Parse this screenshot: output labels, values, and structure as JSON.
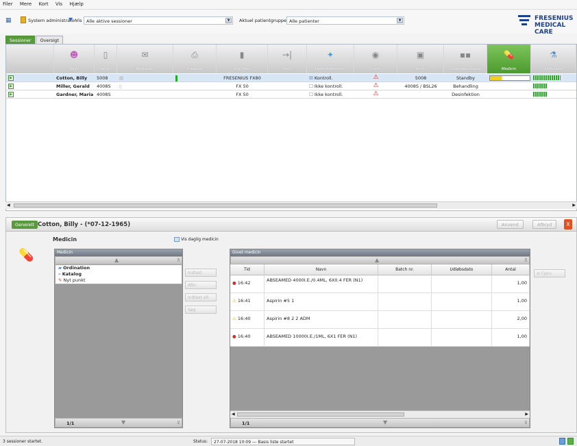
{
  "menu": [
    "Filer",
    "Mere",
    "Kort",
    "Vis",
    "Hjælp"
  ],
  "toolbar": {
    "user": "System administrator",
    "filter_label": "Vis",
    "filter_value": "Alle aktive sessioner",
    "group_label": "Aktuel patientgruppe:",
    "group_value": "Alle patienter"
  },
  "brand": {
    "line1": "FRESENIUS",
    "line2": "MEDICAL CARE",
    "color": "#1b3f8b"
  },
  "tabs": [
    "Sessioner",
    "Oversigt"
  ],
  "grid": {
    "columns": [
      "Navn",
      "Udstyr",
      "Beskeder",
      "Rapport",
      "Dia filter",
      "Stof",
      "Desinfektionsm.",
      "Conn",
      "Kort",
      "Udstyrets status",
      "Medicin",
      "Ordinatio"
    ],
    "rows": [
      {
        "name": "Cotton, Billy",
        "device": "5008",
        "filter": "FRESENIUS FX80",
        "disinf": "Kontroll.",
        "card": "5008",
        "status": "Standby"
      },
      {
        "name": "Miller, Gerald",
        "device": "4008S",
        "filter": "FX 50",
        "disinf": "Ikke kontroll.",
        "card": "4008S / BSL26",
        "status": "Behandling"
      },
      {
        "name": "Gardner, Maria",
        "device": "4008S",
        "filter": "FX 50",
        "disinf": "Ikke kontroll.",
        "card": "",
        "status": "Desinfektion"
      }
    ]
  },
  "panel": {
    "tab": "Generelt",
    "title": "Cotton, Billy - (*07-12-1965)",
    "apply": "Anvend",
    "cancel": "Afbryd",
    "close": "X",
    "section": "Medicin",
    "daily_check": "Vis daglig medicin",
    "left_box": "Medicin",
    "tree": [
      "Ordination",
      "Katalog",
      "Nyt punkt"
    ],
    "side_buttons": [
      "Indtast",
      "Afbr.",
      "Indtast alt",
      "Søg"
    ],
    "right_box": "Givet medicin",
    "remove": "Fjern",
    "given_cols": [
      "Tid",
      "Navn",
      "Batch nr.",
      "Udløbsdato",
      "Antal"
    ],
    "given_rows": [
      {
        "time": "16:42",
        "name": "ABSEAMED 4000I.E./0.4ML, 6X0.4 FER (N1)",
        "qty": "1,00",
        "icon": "red"
      },
      {
        "time": "16:41",
        "name": "Aspirin #5 1",
        "qty": "1,00",
        "icon": "warn"
      },
      {
        "time": "16:40",
        "name": "Aspirin #8 2 2 ADM",
        "qty": "2,00",
        "icon": "warn"
      },
      {
        "time": "16:40",
        "name": "ABSEAMED 10000I.E./1ML, 6X1 FER (N1)",
        "qty": "1,00",
        "icon": "red"
      }
    ],
    "page_left": "1/1",
    "page_right": "1/1"
  },
  "status": {
    "left": "3 sessioner startet.",
    "label": "Status:",
    "text": "27-07-2018 10:09 --- Basis liste startet"
  }
}
